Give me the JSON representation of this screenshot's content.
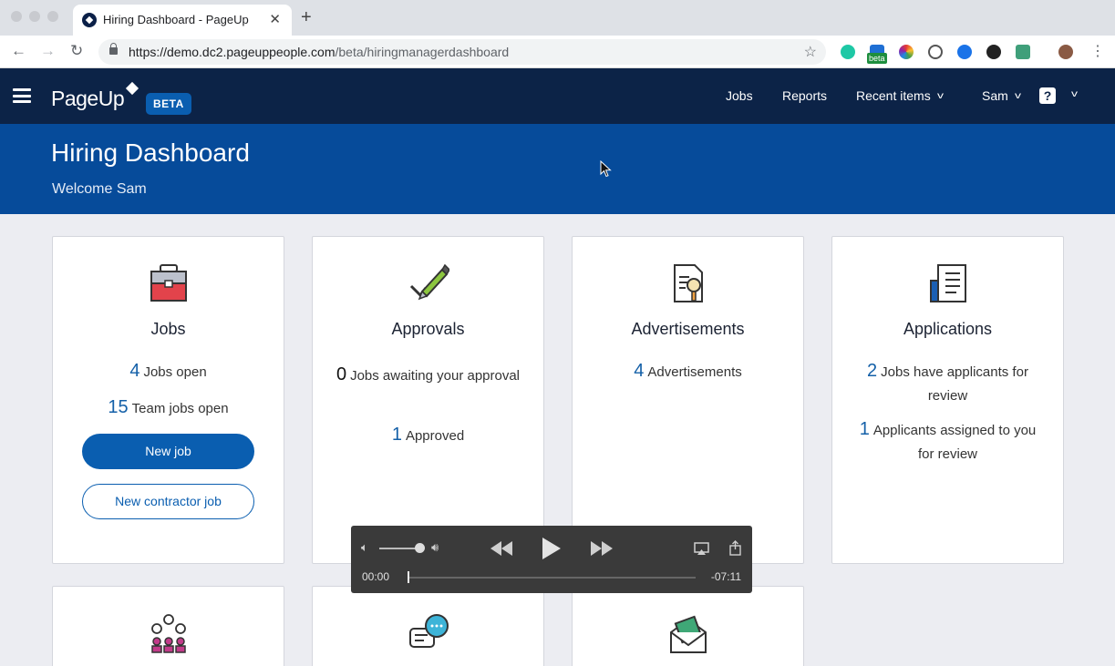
{
  "browser": {
    "tab_title": "Hiring Dashboard - PageUp",
    "url_host": "https://demo.dc2.pageuppeople.com",
    "url_path": "/beta/hiringmanagerdashboard",
    "extension_badge": "beta"
  },
  "header": {
    "logo": "PageUp",
    "beta": "BETA",
    "nav": {
      "jobs": "Jobs",
      "reports": "Reports",
      "recent": "Recent items",
      "user": "Sam",
      "help": "?"
    }
  },
  "banner": {
    "title": "Hiring Dashboard",
    "welcome": "Welcome Sam"
  },
  "cards": {
    "jobs": {
      "title": "Jobs",
      "open_count": "4",
      "open_label": "Jobs open",
      "team_count": "15",
      "team_label": "Team jobs open",
      "new_job": "New job",
      "new_contractor": "New contractor job"
    },
    "approvals": {
      "title": "Approvals",
      "awaiting_count": "0",
      "awaiting_label": "Jobs awaiting your approval",
      "approved_count": "1",
      "approved_label": "Approved"
    },
    "advertisements": {
      "title": "Advertisements",
      "count": "4",
      "label": "Advertisements"
    },
    "applications": {
      "title": "Applications",
      "review_count": "2",
      "review_label": "Jobs have applicants for review",
      "assigned_count": "1",
      "assigned_label": "Applicants assigned to you for review"
    }
  },
  "player": {
    "current": "00:00",
    "remaining": "-07:11"
  },
  "colors": {
    "nav_bg": "#0c2347",
    "banner_bg": "#064b9a",
    "accent": "#0a5eb0",
    "page_bg": "#ecedf2"
  }
}
